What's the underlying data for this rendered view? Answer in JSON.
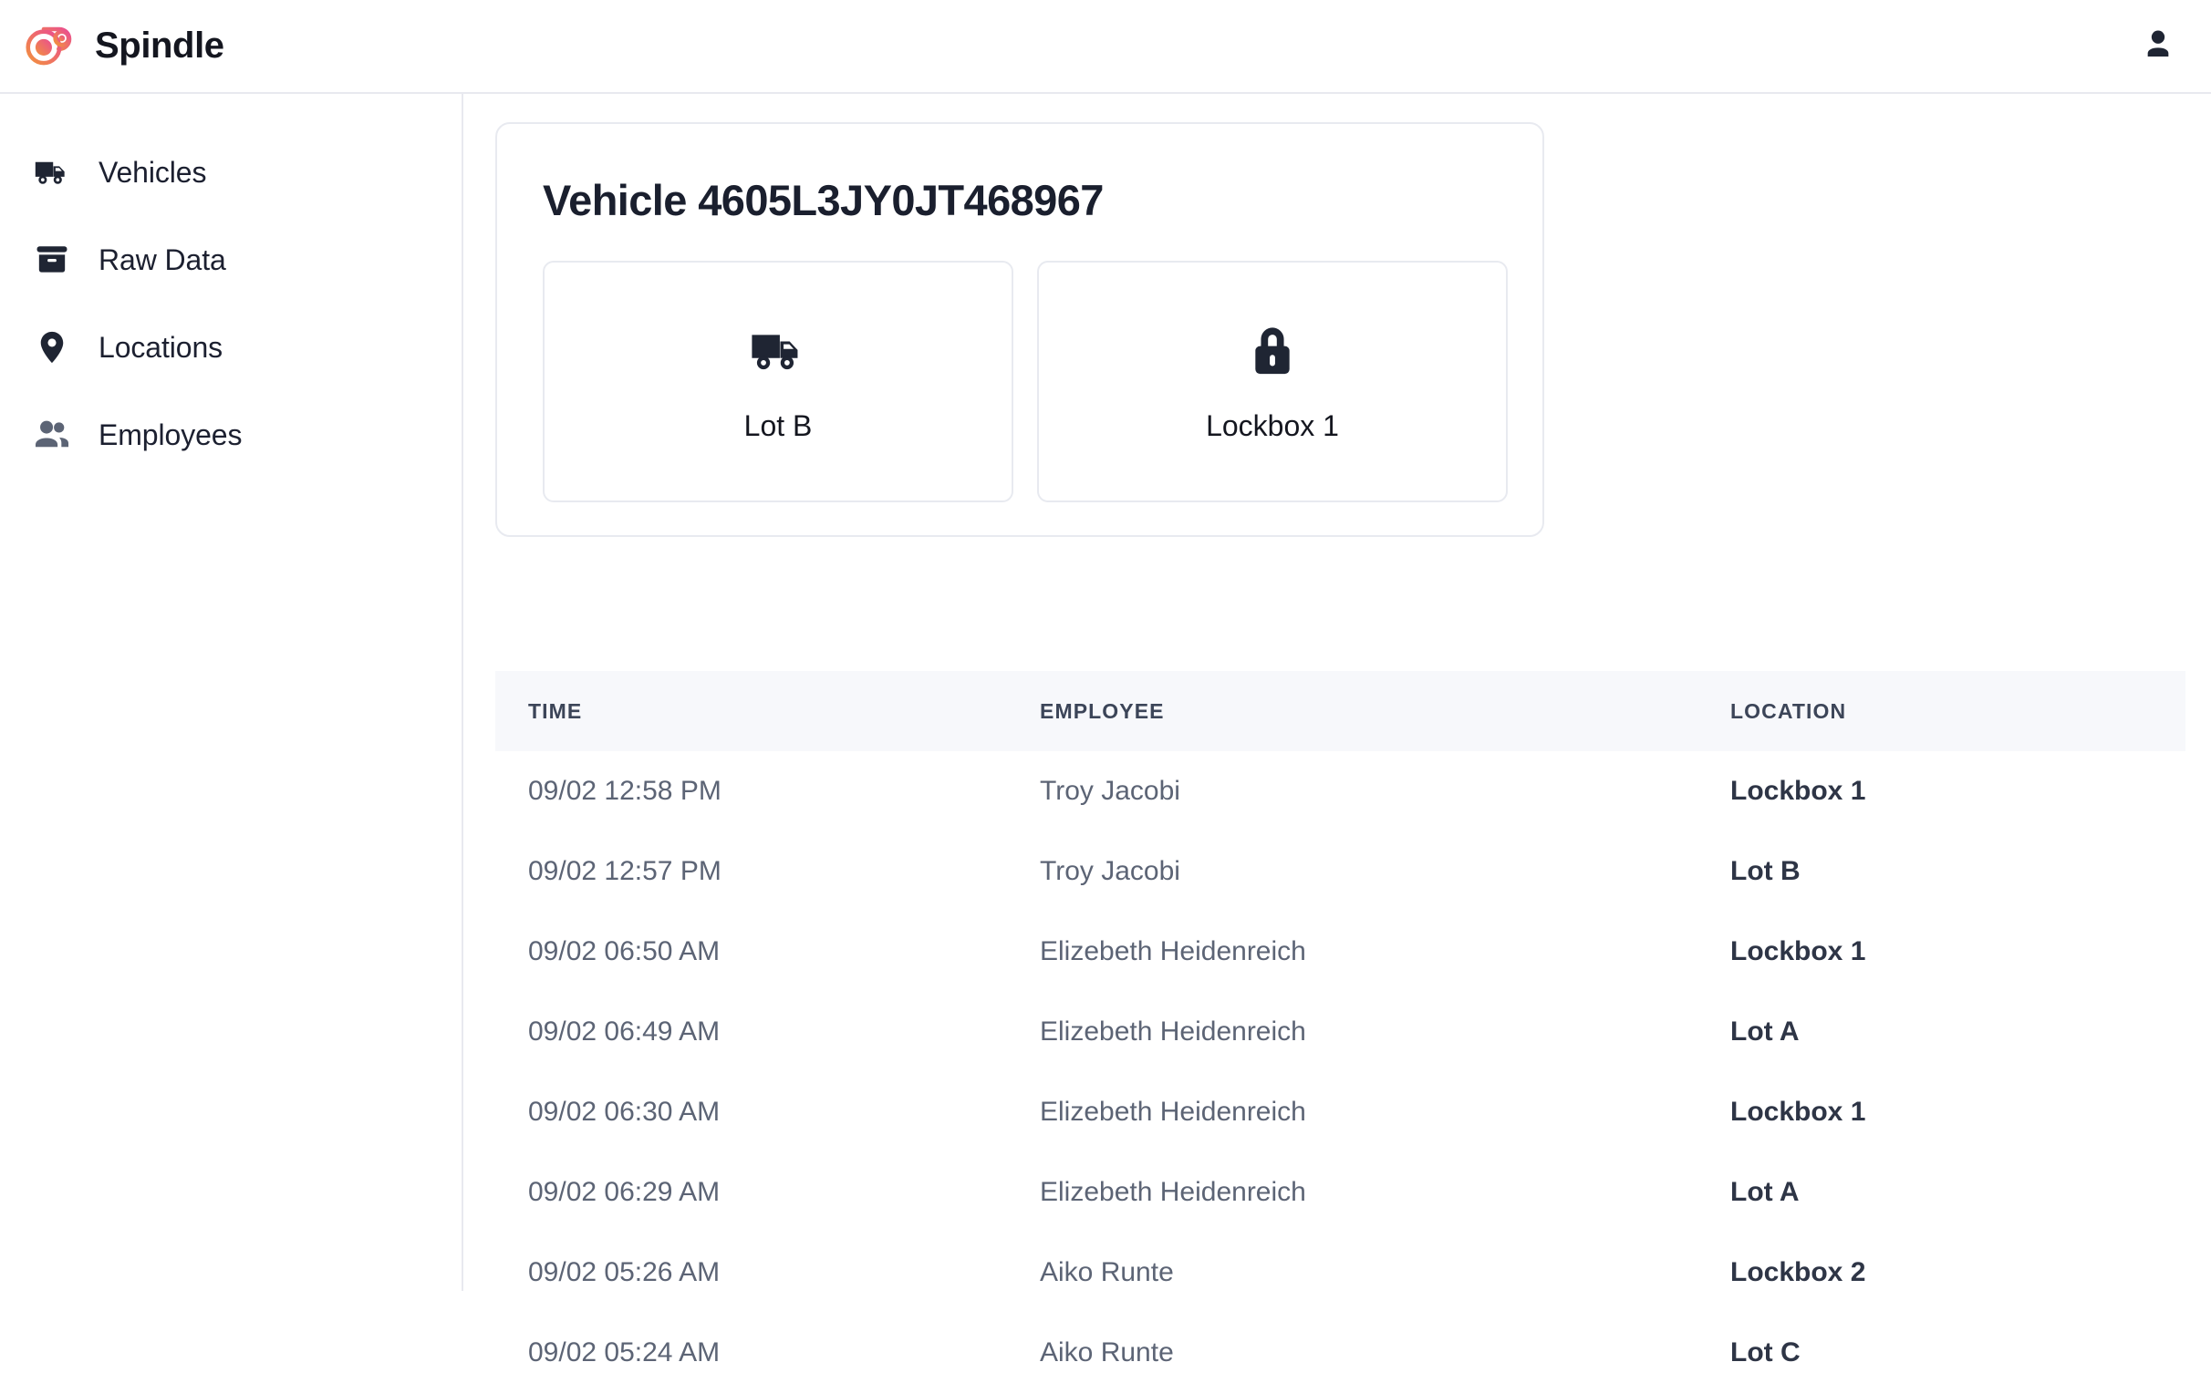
{
  "app": {
    "brand_name": "Spindle",
    "logo_icon": "spindle-logo-icon",
    "user_icon": "user-icon"
  },
  "sidebar": {
    "items": [
      {
        "label": "Vehicles",
        "icon": "truck-icon"
      },
      {
        "label": "Raw Data",
        "icon": "archive-box-icon"
      },
      {
        "label": "Locations",
        "icon": "map-pin-icon"
      },
      {
        "label": "Employees",
        "icon": "users-icon"
      }
    ]
  },
  "vehicle_card": {
    "title": "Vehicle 4605L3JY0JT468967",
    "tiles": [
      {
        "label": "Lot B",
        "icon": "truck-icon"
      },
      {
        "label": "Lockbox 1",
        "icon": "lock-icon"
      }
    ]
  },
  "table": {
    "columns": [
      "TIME",
      "EMPLOYEE",
      "LOCATION"
    ],
    "rows": [
      {
        "time": "09/02 12:58 PM",
        "employee": "Troy Jacobi",
        "location": "Lockbox 1"
      },
      {
        "time": "09/02 12:57 PM",
        "employee": "Troy Jacobi",
        "location": "Lot B"
      },
      {
        "time": "09/02 06:50 AM",
        "employee": "Elizebeth Heidenreich",
        "location": "Lockbox 1"
      },
      {
        "time": "09/02 06:49 AM",
        "employee": "Elizebeth Heidenreich",
        "location": "Lot A"
      },
      {
        "time": "09/02 06:30 AM",
        "employee": "Elizebeth Heidenreich",
        "location": "Lockbox 1"
      },
      {
        "time": "09/02 06:29 AM",
        "employee": "Elizebeth Heidenreich",
        "location": "Lot A"
      },
      {
        "time": "09/02 05:26 AM",
        "employee": "Aiko Runte",
        "location": "Lockbox 2"
      },
      {
        "time": "09/02 05:24 AM",
        "employee": "Aiko Runte",
        "location": "Lot C"
      }
    ]
  },
  "colors": {
    "brand_gradient_start": "#f2913d",
    "brand_gradient_end": "#ea4d92",
    "text_dark": "#1a1f2e",
    "text_muted": "#5c6475",
    "border": "#e8eaf0",
    "header_bg": "#f7f8fb"
  }
}
